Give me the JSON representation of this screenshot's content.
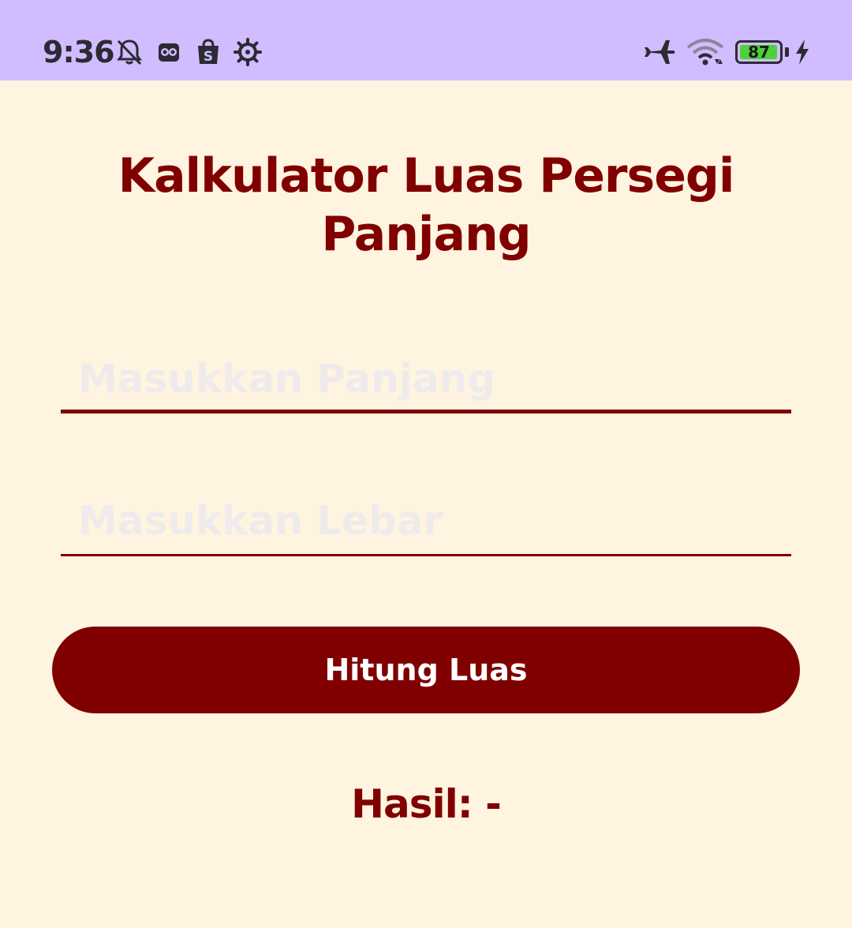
{
  "status_bar": {
    "time": "9:36",
    "battery_level": 87,
    "battery_text": "87",
    "icons": [
      "bell-off-icon",
      "app-owl-icon",
      "shopee-bag-icon",
      "settings-gear-icon",
      "airplane-icon",
      "wifi-icon",
      "battery-icon",
      "charging-bolt-icon"
    ],
    "background_color": "#D0BCFF"
  },
  "app": {
    "title": "Kalkulator Luas Persegi Panjang",
    "panjang_placeholder": "Masukkan Panjang",
    "panjang_value": "",
    "lebar_placeholder": "Masukkan Lebar",
    "lebar_value": "",
    "button_label": "Hitung Luas",
    "result_text": "Hasil: -",
    "accent_color": "#800000",
    "background_color": "#FFF4E0"
  }
}
